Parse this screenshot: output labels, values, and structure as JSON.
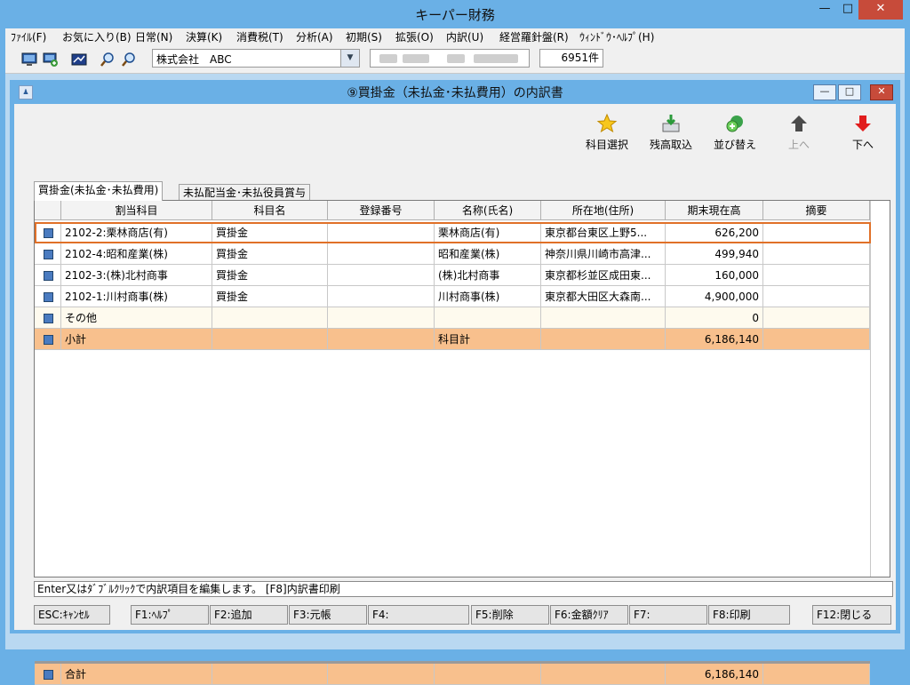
{
  "app": {
    "title": "キーパー財務",
    "window_controls": {
      "minimize": "—",
      "maximize": "□",
      "close": "✕"
    }
  },
  "menu": [
    "ﾌｧｲﾙ(F)",
    "お気に入り(B)",
    "日常(N)",
    "決算(K)",
    "消費税(T)",
    "分析(A)",
    "初期(S)",
    "拡張(O)",
    "内訳(U)",
    "経営羅針盤(R)",
    "ｳｨﾝﾄﾞｳ･ﾍﾙﾌﾟ(H)"
  ],
  "toolbar": {
    "company": "株式会社　ABC",
    "count": "6951件",
    "icons": [
      "monitor-icon",
      "monitor-add-icon",
      "chart-icon",
      "zoom-in-icon",
      "zoom-out-icon"
    ]
  },
  "dialog": {
    "title": "⑨買掛金（未払金･未払費用）の内訳書",
    "actions": [
      {
        "label": "科目選択",
        "icon": "star-icon",
        "enabled": true
      },
      {
        "label": "残高取込",
        "icon": "import-icon",
        "enabled": true
      },
      {
        "label": "並び替え",
        "icon": "sort-icon",
        "enabled": true
      },
      {
        "label": "上へ",
        "icon": "arrow-up-icon",
        "enabled": false
      },
      {
        "label": "下へ",
        "icon": "arrow-down-icon",
        "enabled": true
      }
    ],
    "tabs": [
      {
        "label": "買掛金(未払金･未払費用)",
        "active": true
      },
      {
        "label": "未払配当金･未払役員賞与",
        "active": false
      }
    ],
    "columns": [
      "割当科目",
      "科目名",
      "登録番号",
      "名称(氏名)",
      "所在地(住所)",
      "期末現在高",
      "摘要"
    ],
    "rows": [
      [
        "2102-2:栗林商店(有)",
        "買掛金",
        "",
        "栗林商店(有)",
        "東京都台東区上野5...",
        "626,200",
        ""
      ],
      [
        "2102-4:昭和産業(株)",
        "買掛金",
        "",
        "昭和産業(株)",
        "神奈川県川崎市高津...",
        "499,940",
        ""
      ],
      [
        "2102-3:(株)北村商事",
        "買掛金",
        "",
        "(株)北村商事",
        "東京都杉並区成田東...",
        "160,000",
        ""
      ],
      [
        "2102-1:川村商事(株)",
        "買掛金",
        "",
        "川村商事(株)",
        "東京都大田区大森南...",
        "4,900,000",
        ""
      ],
      [
        "その他",
        "",
        "",
        "",
        "",
        "0",
        ""
      ],
      [
        "小計",
        "",
        "",
        "科目計",
        "",
        "6,186,140",
        ""
      ]
    ],
    "total": [
      "合計",
      "",
      "",
      "",
      "",
      "6,186,140",
      ""
    ],
    "status": "Enter又はﾀﾞﾌﾞﾙｸﾘｯｸで内訳項目を編集します。 [F8]内訳書印刷",
    "fkeys": [
      "ESC:ｷｬﾝｾﾙ",
      "F1:ﾍﾙﾌﾟ",
      "F2:追加",
      "F3:元帳",
      "F4:",
      "F5:削除",
      "F6:金額ｸﾘｱ",
      "F7:",
      "F8:印刷",
      "F12:閉じる"
    ]
  }
}
